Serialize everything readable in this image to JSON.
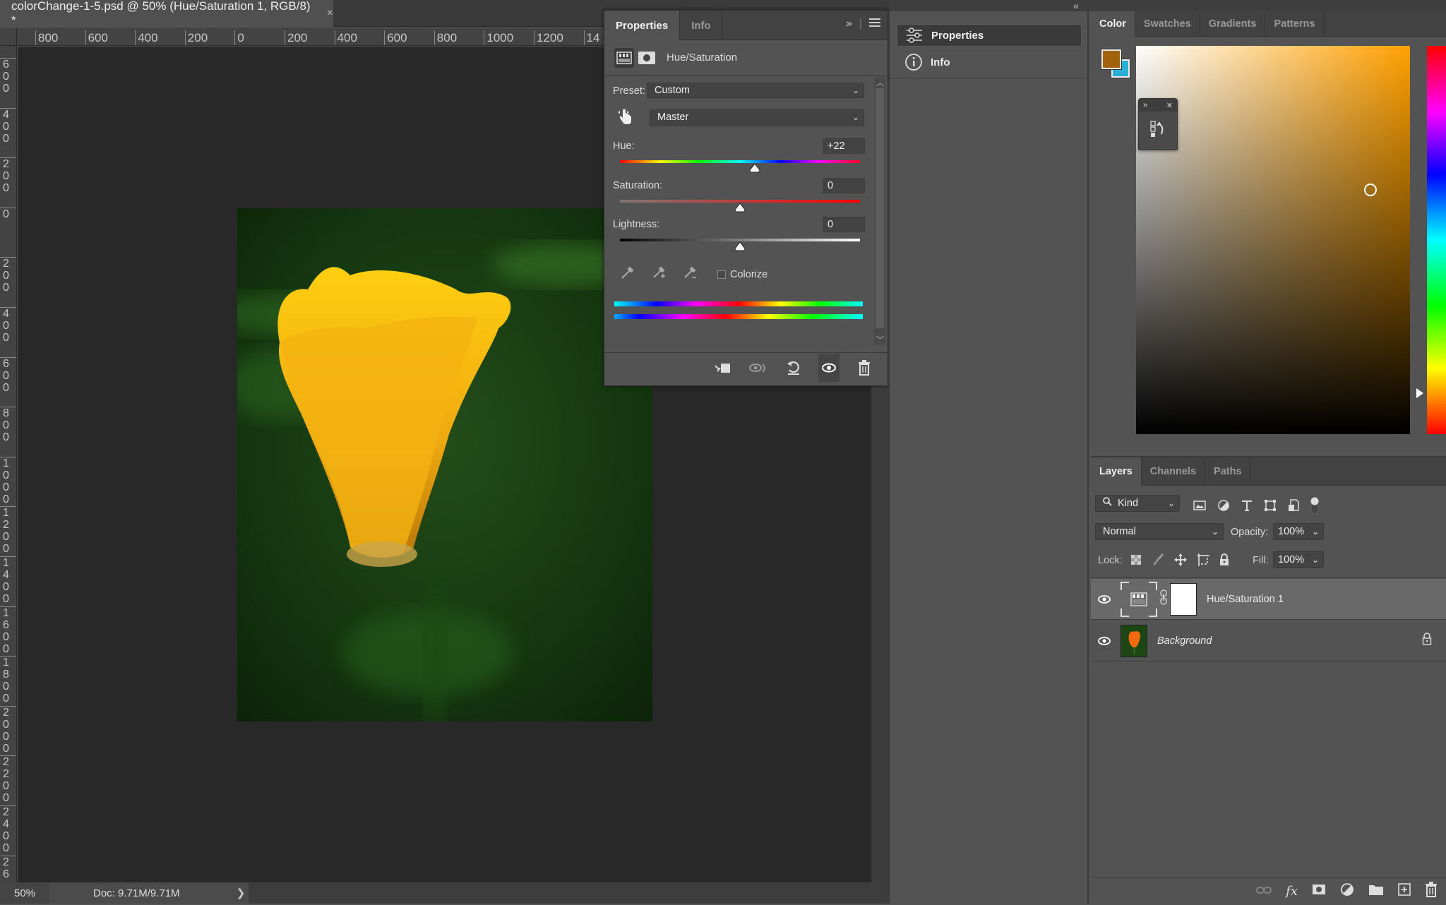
{
  "document": {
    "tab_title": "colorChange-1-5.psd @ 50% (Hue/Saturation 1, RGB/8) *",
    "close_glyph": "×"
  },
  "rulers": {
    "horizontal": [
      "800",
      "600",
      "400",
      "200",
      "0",
      "200",
      "400",
      "600",
      "800",
      "1000",
      "1200",
      "14"
    ],
    "vertical": [
      "600",
      "400",
      "200",
      "0",
      "200",
      "400",
      "600",
      "800",
      "1000",
      "1200",
      "1400",
      "1600",
      "1800",
      "2000",
      "2200",
      "2400",
      "26"
    ]
  },
  "status_bar": {
    "zoom": "50%",
    "doc_size": "Doc: 9.71M/9.71M",
    "arrow": "❯"
  },
  "properties_panel": {
    "tabs": [
      {
        "label": "Properties",
        "active": true
      },
      {
        "label": "Info",
        "active": false
      }
    ],
    "expand_glyph": "»",
    "title": "Hue/Saturation",
    "preset_label": "Preset:",
    "preset_value": "Custom",
    "channel_value": "Master",
    "hue": {
      "label": "Hue:",
      "value": "+22",
      "range": [
        -180,
        180
      ]
    },
    "saturation": {
      "label": "Saturation:",
      "value": "0",
      "range": [
        -100,
        100
      ]
    },
    "lightness": {
      "label": "Lightness:",
      "value": "0",
      "range": [
        -100,
        100
      ]
    },
    "colorize_label": "Colorize",
    "colorize_checked": false
  },
  "collapsed_dock": {
    "collapse_glyph": "«",
    "items": [
      {
        "label": "Properties",
        "icon": "sliders-icon",
        "active": true
      },
      {
        "label": "Info",
        "icon": "info-icon",
        "active": false
      }
    ]
  },
  "color_panel": {
    "tabs": [
      {
        "label": "Color",
        "active": true
      },
      {
        "label": "Swatches",
        "active": false
      },
      {
        "label": "Gradients",
        "active": false
      },
      {
        "label": "Patterns",
        "active": false
      }
    ],
    "foreground_color": "#a0620a",
    "background_color": "#2bafd4",
    "hue_base_color": "#ffa000"
  },
  "layers_panel": {
    "tabs": [
      {
        "label": "Layers",
        "active": true
      },
      {
        "label": "Channels",
        "active": false
      },
      {
        "label": "Paths",
        "active": false
      }
    ],
    "filter_kind": "Kind",
    "blend_mode": "Normal",
    "opacity_label": "Opacity:",
    "opacity_value": "100%",
    "lock_label": "Lock:",
    "fill_label": "Fill:",
    "fill_value": "100%",
    "layers": [
      {
        "name": "Hue/Saturation 1",
        "selected": true,
        "visible": true,
        "type": "adjustment"
      },
      {
        "name": "Background",
        "selected": false,
        "visible": true,
        "type": "image",
        "locked": true
      }
    ]
  }
}
